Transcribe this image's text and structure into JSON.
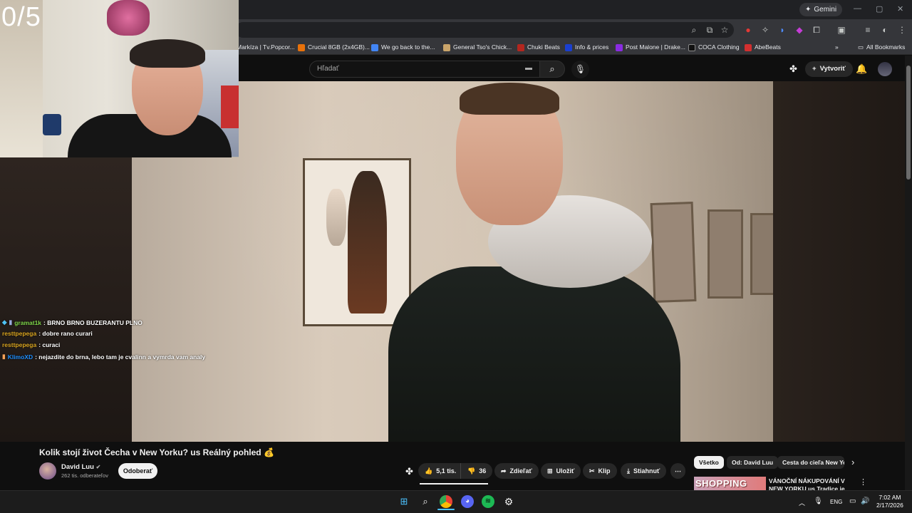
{
  "browser": {
    "gemini_label": "Gemini",
    "bookmarks": [
      {
        "label": "Markíza | Tv.Popcor...",
        "color": "#3a3a3a"
      },
      {
        "label": "Crucial 8GB (2x4GB)...",
        "color": "#e8710a"
      },
      {
        "label": "We go back to the...",
        "color": "#4285f4"
      },
      {
        "label": "General Tso's Chick...",
        "color": "#c9a46a"
      },
      {
        "label": "Chuki Beats",
        "color": "#b3261e"
      },
      {
        "label": "Info & prices",
        "color": "#1a3fd0"
      },
      {
        "label": "Post Malone | Drake...",
        "color": "#8a2be2"
      },
      {
        "label": "COCA Clothing",
        "color": "#111111"
      },
      {
        "label": "AbeBeats",
        "color": "#d32f2f"
      }
    ],
    "all_bookmarks": "All Bookmarks"
  },
  "youtube": {
    "search_placeholder": "Hľadať",
    "create_label": "Vytvoriť",
    "video_title": "Kolik stojí život Čecha v New Yorku? us Reálný pohled 💰",
    "channel_name": "David Luu",
    "subscribers": "262 tis. odberateľov",
    "subscribe_label": "Odoberať",
    "likes": "5,1 tis.",
    "dislikes": "36",
    "share_label": "Zdieľať",
    "save_label": "Uložiť",
    "clip_label": "Klip",
    "download_label": "Stiahnuť",
    "chips": [
      "Všetko",
      "Od: David Luu",
      "Cesta do cieľa New Yo"
    ],
    "recommended": {
      "thumb_text": "SHOPPING",
      "title": "VÁNOČNÍ NÁKUPOVÁNÍ V NEW YORKU us Tradice je tradice"
    }
  },
  "stream": {
    "counter": "0/5",
    "chat": [
      {
        "user": "gramat1k",
        "user_color": "#7fd54a",
        "message": ": BRNO BRNO BUZERANTU PLNO"
      },
      {
        "user": "resttpepega",
        "user_color": "#daa520",
        "message": ": dobre rano curari"
      },
      {
        "user": "resttpepega",
        "user_color": "#daa520",
        "message": ": curaci"
      },
      {
        "user": "KlimoXD",
        "user_color": "#1e90ff",
        "message": ": nejazdite do brna, lebo tam je cvalinn a vymrda vam analy"
      }
    ]
  },
  "taskbar": {
    "language": "ENG",
    "time": "7:02 AM",
    "date": "2/17/2026"
  }
}
